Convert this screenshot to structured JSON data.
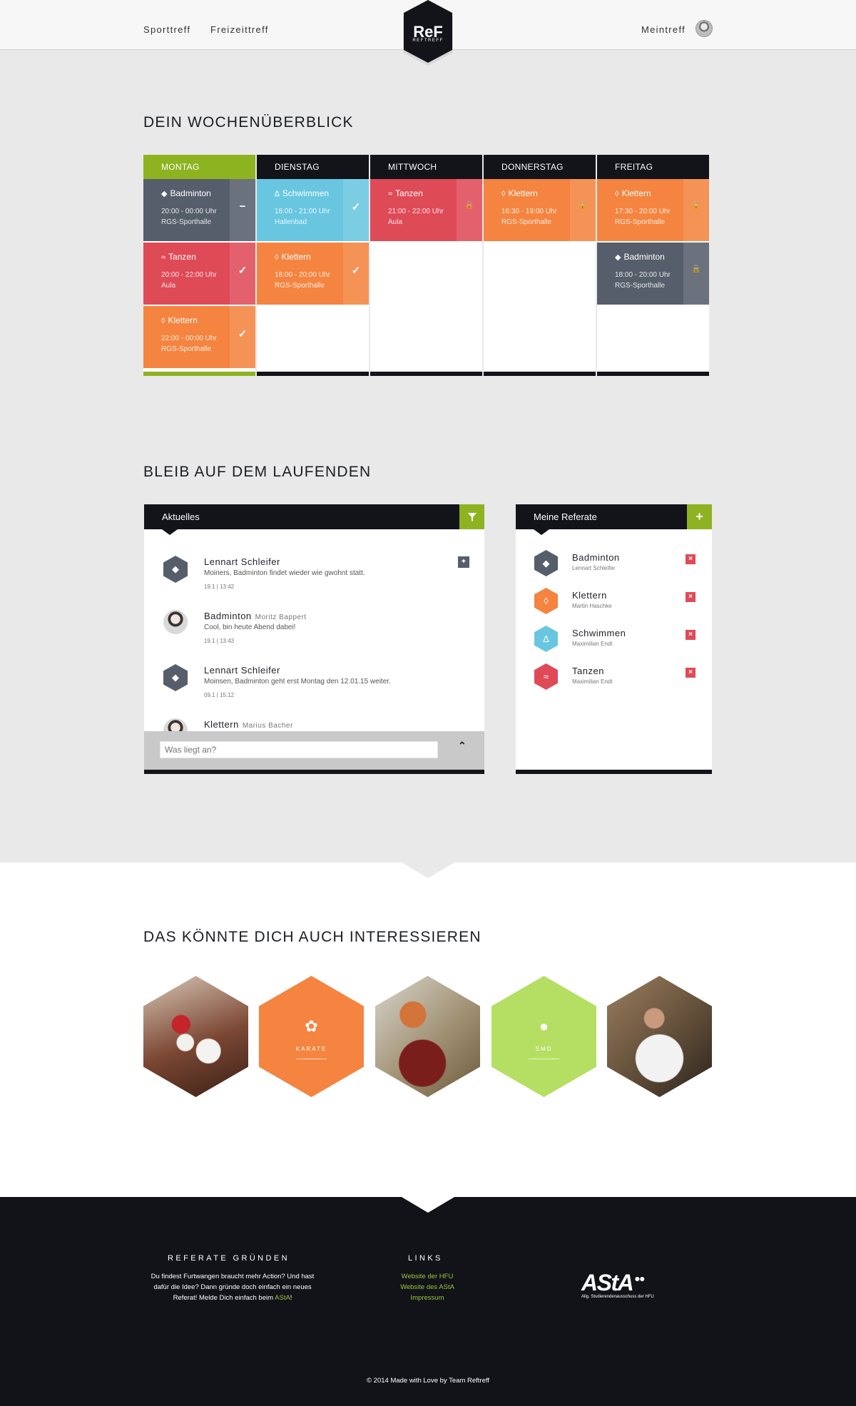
{
  "header": {
    "nav_left": [
      "Sporttreff",
      "Freizeittreff"
    ],
    "nav_right": "Meintreff",
    "logo_text": "REFTREFF"
  },
  "week": {
    "title": "DEIN WOCHENÜBERBLICK",
    "days": [
      {
        "label": "MONTAG",
        "active": true,
        "events": [
          {
            "title": "Badminton",
            "icon": "shuttlecock-icon",
            "time": "20:00 - 00:00 Uhr",
            "place": "RGS-Sporthalle",
            "color": "#565e6b",
            "status": "minus-icon"
          },
          {
            "title": "Tanzen",
            "icon": "dancer-icon",
            "time": "20:00 - 22:00 Uhr",
            "place": "Aula",
            "color": "#df4a57",
            "status": "check-icon"
          },
          {
            "title": "Klettern",
            "icon": "climbing-icon",
            "time": "22:00 - 00:00 Uhr",
            "place": "RGS-Sporthalle",
            "color": "#f4843f",
            "status": "check-icon"
          }
        ]
      },
      {
        "label": "DIENSTAG",
        "active": false,
        "events": [
          {
            "title": "Schwimmen",
            "icon": "swimming-icon",
            "time": "18:00 - 21:00 Uhr",
            "place": "Hallenbad",
            "color": "#68c6e0",
            "status": "check-icon"
          },
          {
            "title": "Klettern",
            "icon": "climbing-icon",
            "time": "18:00 - 20:00 Uhr",
            "place": "RGS-Sporthalle",
            "color": "#f4843f",
            "status": "check-icon"
          }
        ]
      },
      {
        "label": "MITTWOCH",
        "active": false,
        "events": [
          {
            "title": "Tanzen",
            "icon": "dancer-icon",
            "time": "21:00 - 22:00 Uhr",
            "place": "Aula",
            "color": "#df4a57",
            "status": "lock-icon"
          }
        ]
      },
      {
        "label": "DONNERSTAG",
        "active": false,
        "events": [
          {
            "title": "Klettern",
            "icon": "climbing-icon",
            "time": "16:30 - 19:00 Uhr",
            "place": "RGS-Sporthalle",
            "color": "#f4843f",
            "status": "lock-icon"
          }
        ]
      },
      {
        "label": "FREITAG",
        "active": false,
        "events": [
          {
            "title": "Klettern",
            "icon": "climbing-icon",
            "time": "17:30 - 20:00 Uhr",
            "place": "RGS-Sporthalle",
            "color": "#f4843f",
            "status": "lock-icon"
          },
          {
            "title": "Badminton",
            "icon": "shuttlecock-icon",
            "time": "18:00 - 20:00 Uhr",
            "place": "RGS-Sporthalle",
            "color": "#565e6b",
            "status": "lock-icon"
          }
        ]
      }
    ]
  },
  "updates": {
    "title": "BLEIB AUF DEM LAUFENDEN",
    "feed": {
      "header": "Aktuelles",
      "items": [
        {
          "name": "Lennart Schleifer",
          "sub": "",
          "text": "Moiners, Badminton findet wieder wie gwohnt statt.",
          "date": "19.1  |  13:42",
          "avatar": "shuttlecock-hex-icon",
          "pinned": true
        },
        {
          "name": "Badminton",
          "sub": "Moritz Bappert",
          "text": "Cool, bin heute Abend dabei!",
          "date": "19.1  |  13:43",
          "avatar": "user-avatar",
          "pinned": false
        },
        {
          "name": "Lennart Schleifer",
          "sub": "",
          "text": "Moinsen, Badminton geht erst Montag den 12.01.15 weiter.",
          "date": "09.1  |  15:12",
          "avatar": "shuttlecock-hex-icon",
          "pinned": false
        },
        {
          "name": "Klettern",
          "sub": "Marius Bacher",
          "text": "",
          "date": "",
          "avatar": "user-avatar",
          "pinned": false
        }
      ],
      "composer_placeholder": "Was liegt an?"
    },
    "referate": {
      "header": "Meine Referate",
      "items": [
        {
          "name": "Badminton",
          "by": "Lennart Schleifer",
          "color": "#565e6b",
          "icon": "shuttlecock-icon"
        },
        {
          "name": "Klettern",
          "by": "Martin Haschke",
          "color": "#f4843f",
          "icon": "climbing-icon"
        },
        {
          "name": "Schwimmen",
          "by": "Maximilian Endt",
          "color": "#68c6e0",
          "icon": "swimming-icon"
        },
        {
          "name": "Tanzen",
          "by": "Maximilian Endt",
          "color": "#df4a57",
          "icon": "dancer-icon"
        }
      ]
    }
  },
  "interests": {
    "title": "DAS KÖNNTE DICH AUCH INTERESSIEREN",
    "tiles": [
      {
        "label": "",
        "kind": "photo-dice",
        "color": "#8a4a3a"
      },
      {
        "label": "KARATE",
        "kind": "color",
        "color": "#f4843f",
        "icon": "karate-icon"
      },
      {
        "label": "",
        "kind": "photo-basketball",
        "color": "#b8a27a"
      },
      {
        "label": "SMD",
        "kind": "color",
        "color": "#b4df62",
        "icon": "speech-bubble-icon"
      },
      {
        "label": "",
        "kind": "photo-handball",
        "color": "#6a5a45"
      }
    ]
  },
  "footer": {
    "col1_title": "REFERATE GRÜNDEN",
    "col1_text_a": "Du findest Furtwangen braucht mehr Action? Und hast",
    "col1_text_b": "dafür die Idee? Dann gründe doch einfach ein neues",
    "col1_text_c": "Referat! Melde Dich einfach beim ",
    "col1_link": "AStA",
    "col1_end": "!",
    "col2_title": "LINKS",
    "links": [
      "Website der HFU",
      "Website des AStA",
      "Impressum"
    ],
    "asta_logo": "AStA",
    "asta_sub": "Allg. Studierendenausschuss der HFU",
    "copyright": "© 2014 Made with Love by Team Reftreff"
  }
}
